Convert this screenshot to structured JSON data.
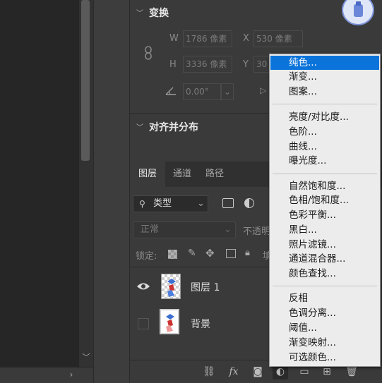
{
  "transform": {
    "title": "变换",
    "w_label": "W",
    "w_value": "1786 像素",
    "x_label": "X",
    "x_value": "530 像素",
    "h_label": "H",
    "h_value": "3336 像素",
    "y_label": "Y",
    "y_value": "30",
    "angle_value": "0.00°"
  },
  "align": {
    "title": "对齐并分布"
  },
  "layers_panel": {
    "tabs": [
      "图层",
      "通道",
      "路径"
    ],
    "filter_type": "类型",
    "blend_mode": "正常",
    "opacity_label": "不透明",
    "lock_label": "锁定:",
    "fill_label_partial": "填",
    "layers": [
      {
        "name": "图层 1",
        "visible": true
      },
      {
        "name": "背景",
        "visible": false
      }
    ]
  },
  "adjustment_menu": {
    "groups": [
      [
        "纯色...",
        "渐变...",
        "图案..."
      ],
      [
        "亮度/对比度...",
        "色阶...",
        "曲线...",
        "曝光度..."
      ],
      [
        "自然饱和度...",
        "色相/饱和度...",
        "色彩平衡...",
        "黑白...",
        "照片滤镜...",
        "通道混合器...",
        "颜色查找..."
      ],
      [
        "反相",
        "色调分离...",
        "阈值...",
        "渐变映射...",
        "可选颜色..."
      ]
    ],
    "selected": "纯色..."
  },
  "colors": {
    "menu_highlight": "#0a74da",
    "panel_bg": "#3a3a3a"
  }
}
